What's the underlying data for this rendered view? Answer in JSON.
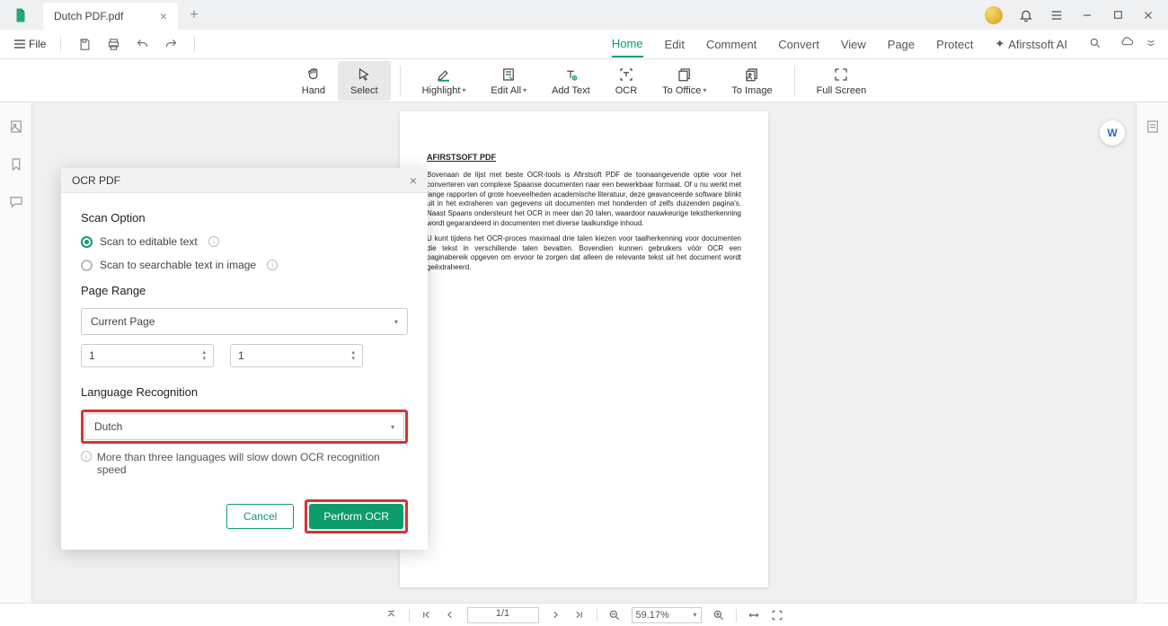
{
  "tab": {
    "title": "Dutch PDF.pdf"
  },
  "file_menu": {
    "label": "File"
  },
  "menu": {
    "home": "Home",
    "edit": "Edit",
    "comment": "Comment",
    "convert": "Convert",
    "view": "View",
    "page": "Page",
    "protect": "Protect",
    "ai": "Afirstsoft AI"
  },
  "toolbar": {
    "hand": "Hand",
    "select": "Select",
    "highlight": "Highlight",
    "edit_all": "Edit All",
    "add_text": "Add Text",
    "ocr": "OCR",
    "to_office": "To Office",
    "to_image": "To Image",
    "full_screen": "Full Screen"
  },
  "document": {
    "heading": "AFIRSTSOFT PDF",
    "para1": "Bovenaan de lijst met beste OCR-tools is Afirstsoft PDF de toonaangevende optie voor het converteren van complexe Spaanse documenten naar een bewerkbaar formaat. Of u nu werkt met lange rapporten of grote hoeveelheden academische literatuur, deze geavanceerde software blinkt uit in het extraheren van gegevens uit documenten met honderden of zelfs duizenden pagina's. Naast Spaans ondersteunt het OCR in meer dan 20 talen, waardoor nauwkeurige tekstherkenning wordt gegarandeerd in documenten met diverse taalkundige inhoud.",
    "para2": "U kunt tijdens het OCR-proces maximaal drie talen kiezen voor taalherkenning voor documenten die tekst in verschillende talen bevatten. Bovendien kunnen gebruikers vóór OCR een paginabereik opgeven om ervoor te zorgen dat alleen de relevante tekst uit het document wordt geëxtraheerd."
  },
  "modal": {
    "title": "OCR PDF",
    "scan_option_label": "Scan Option",
    "opt_editable": "Scan to editable text",
    "opt_searchable": "Scan to searchable text in image",
    "page_range_label": "Page Range",
    "page_range_value": "Current Page",
    "range_from": "1",
    "range_to": "1",
    "language_label": "Language Recognition",
    "language_value": "Dutch",
    "note": "More than three languages will slow down OCR recognition speed",
    "cancel": "Cancel",
    "perform": "Perform OCR"
  },
  "statusbar": {
    "page": "1/1",
    "zoom": "59.17%"
  }
}
